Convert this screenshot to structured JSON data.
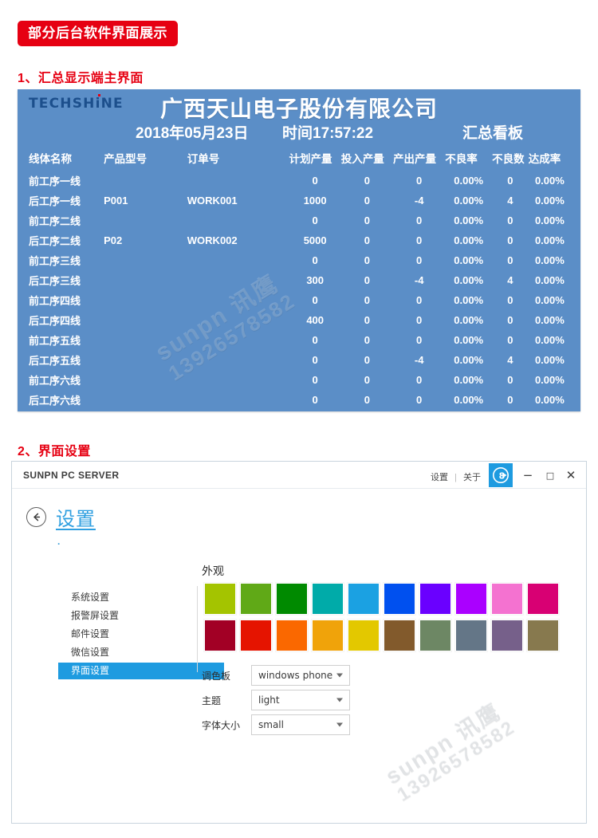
{
  "badge": {
    "label": "部分后台软件界面展示"
  },
  "sections": [
    {
      "index": "1",
      "title": "1、汇总显示端主界面"
    },
    {
      "index": "2",
      "title": "2、界面设置"
    }
  ],
  "dashboard": {
    "logo_text": "TECHSHiNE",
    "company": "广西天山电子股份有限公司",
    "date": "2018年05月23日",
    "time": "时间17:57:22",
    "board_label": "汇总看板",
    "columns": [
      "线体名称",
      "产品型号",
      "订单号",
      "计划产量",
      "投入产量",
      "产出产量",
      "不良率",
      "不良数",
      "达成率"
    ],
    "rows": [
      {
        "line": "前工序一线",
        "model": "",
        "order": "",
        "planned": "0",
        "input": "0",
        "output": "0",
        "defect_rate": "0.00%",
        "defects": "0",
        "achieve_rate": "0.00%"
      },
      {
        "line": "后工序一线",
        "model": "P001",
        "order": "WORK001",
        "planned": "1000",
        "input": "0",
        "output": "-4",
        "defect_rate": "0.00%",
        "defects": "4",
        "achieve_rate": "0.00%"
      },
      {
        "line": "前工序二线",
        "model": "",
        "order": "",
        "planned": "0",
        "input": "0",
        "output": "0",
        "defect_rate": "0.00%",
        "defects": "0",
        "achieve_rate": "0.00%"
      },
      {
        "line": "后工序二线",
        "model": "P02",
        "order": "WORK002",
        "planned": "5000",
        "input": "0",
        "output": "0",
        "defect_rate": "0.00%",
        "defects": "0",
        "achieve_rate": "0.00%"
      },
      {
        "line": "前工序三线",
        "model": "",
        "order": "",
        "planned": "0",
        "input": "0",
        "output": "0",
        "defect_rate": "0.00%",
        "defects": "0",
        "achieve_rate": "0.00%"
      },
      {
        "line": "后工序三线",
        "model": "",
        "order": "",
        "planned": "300",
        "input": "0",
        "output": "-4",
        "defect_rate": "0.00%",
        "defects": "4",
        "achieve_rate": "0.00%"
      },
      {
        "line": "前工序四线",
        "model": "",
        "order": "",
        "planned": "0",
        "input": "0",
        "output": "0",
        "defect_rate": "0.00%",
        "defects": "0",
        "achieve_rate": "0.00%"
      },
      {
        "line": "后工序四线",
        "model": "",
        "order": "",
        "planned": "400",
        "input": "0",
        "output": "0",
        "defect_rate": "0.00%",
        "defects": "0",
        "achieve_rate": "0.00%"
      },
      {
        "line": "前工序五线",
        "model": "",
        "order": "",
        "planned": "0",
        "input": "0",
        "output": "0",
        "defect_rate": "0.00%",
        "defects": "0",
        "achieve_rate": "0.00%"
      },
      {
        "line": "后工序五线",
        "model": "",
        "order": "",
        "planned": "0",
        "input": "0",
        "output": "-4",
        "defect_rate": "0.00%",
        "defects": "4",
        "achieve_rate": "0.00%"
      },
      {
        "line": "前工序六线",
        "model": "",
        "order": "",
        "planned": "0",
        "input": "0",
        "output": "0",
        "defect_rate": "0.00%",
        "defects": "0",
        "achieve_rate": "0.00%"
      },
      {
        "line": "后工序六线",
        "model": "",
        "order": "",
        "planned": "0",
        "input": "0",
        "output": "0",
        "defect_rate": "0.00%",
        "defects": "0",
        "achieve_rate": "0.00%"
      }
    ],
    "background_color": "#5b8ec7",
    "watermark": {
      "brand": "sunpn 讯鹰",
      "phone": "13926578582"
    }
  },
  "window": {
    "app_title": "SUNPN PC SERVER",
    "titlebar_links": [
      "设置",
      "关于"
    ],
    "brand_icon": "sunpn-logo-icon",
    "controls": {
      "minimize": "−",
      "maximize": "□",
      "close": "✕"
    },
    "back_icon": "back-arrow-icon",
    "page_heading": "设置",
    "tiny_marker": "·",
    "nav_items": [
      {
        "label": "系统设置",
        "active": false
      },
      {
        "label": "报警屏设置",
        "active": false
      },
      {
        "label": "邮件设置",
        "active": false
      },
      {
        "label": "微信设置",
        "active": false
      },
      {
        "label": "界面设置",
        "active": true
      }
    ],
    "appearance": {
      "title": "外观",
      "accent_color": "#1e9be0",
      "swatches": [
        "#a4c400",
        "#60a917",
        "#008a00",
        "#00aba9",
        "#1ba1e2",
        "#0050ef",
        "#6a00ff",
        "#aa00ff",
        "#f472d0",
        "#d80073",
        "#a20025",
        "#e51400",
        "#fa6800",
        "#f0a30a",
        "#e3c800",
        "#825a2c",
        "#6d8764",
        "#647687",
        "#76608a",
        "#87794e"
      ],
      "fields": [
        {
          "label": "调色板",
          "value": "windows phone"
        },
        {
          "label": "主题",
          "value": "light"
        },
        {
          "label": "字体大小",
          "value": "small"
        }
      ]
    },
    "watermark": {
      "brand": "sunpn 讯鹰",
      "phone": "13926578582"
    }
  }
}
